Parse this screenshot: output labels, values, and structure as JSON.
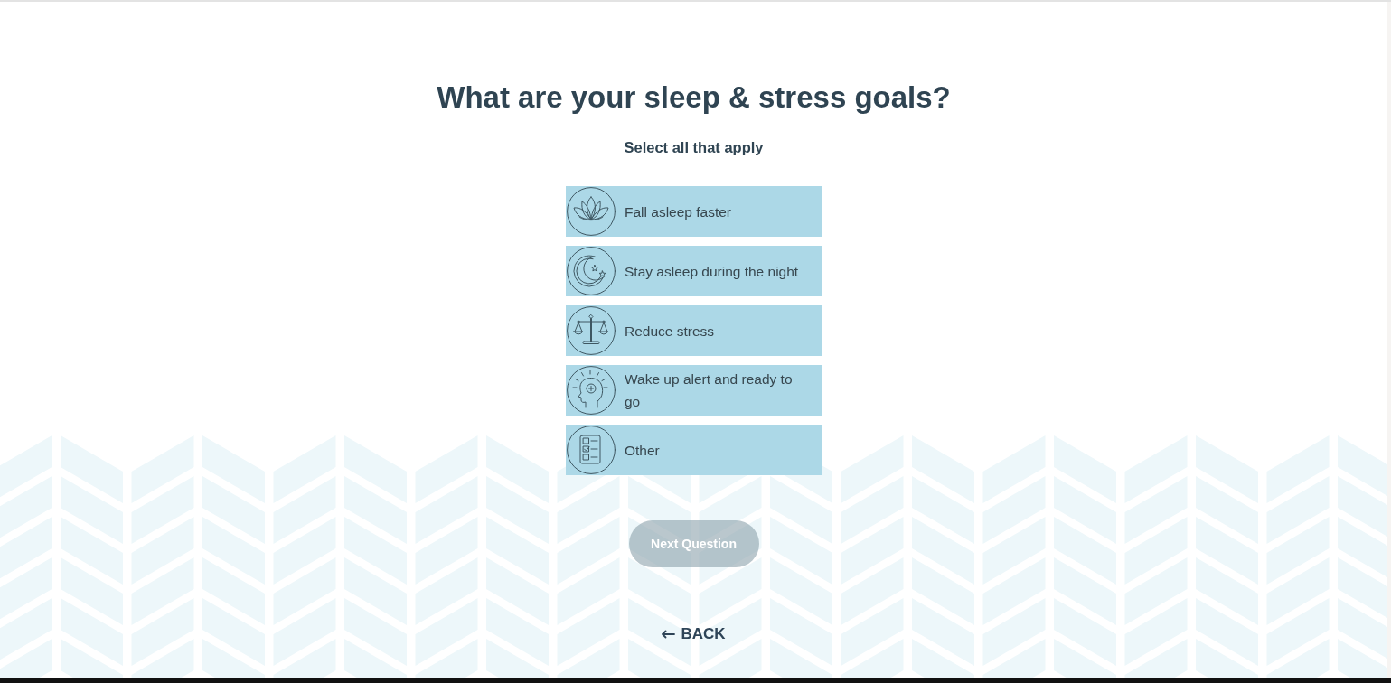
{
  "heading": "What are your sleep & stress goals?",
  "subheading": "Select all that apply",
  "options": [
    {
      "label": "Fall asleep faster",
      "selected": false
    },
    {
      "label": "Stay asleep during the night",
      "selected": false
    },
    {
      "label": "Reduce stress",
      "selected": false
    },
    {
      "label": "Wake up alert and ready to go",
      "selected": false
    },
    {
      "label": "Other",
      "selected": false
    }
  ],
  "next_button": {
    "label": "Next Question",
    "disabled": true
  },
  "back_link": {
    "label": "BACK"
  }
}
